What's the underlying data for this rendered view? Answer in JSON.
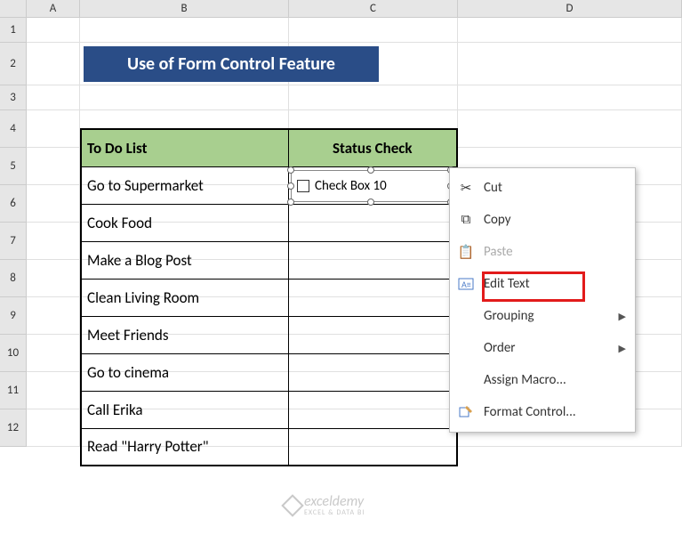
{
  "columns": [
    "A",
    "B",
    "C",
    "D"
  ],
  "rows": [
    "1",
    "2",
    "3",
    "4",
    "5",
    "6",
    "7",
    "8",
    "9",
    "10",
    "11",
    "12"
  ],
  "title": "Use of Form Control Feature",
  "headers": {
    "todo": "To Do List",
    "status": "Status Check"
  },
  "tasks": [
    "Go to Supermarket",
    "Cook Food",
    "Make a Blog Post",
    "Clean Living Room",
    "Meet Friends",
    "Go to cinema",
    "Call Erika",
    "Read \"Harry Potter\""
  ],
  "checkbox_label": "Check Box 10",
  "menu": {
    "cut": "Cut",
    "copy": "Copy",
    "paste": "Paste",
    "edit_text": "Edit Text",
    "grouping": "Grouping",
    "order": "Order",
    "assign_macro": "Assign Macro...",
    "format_control": "Format Control..."
  },
  "watermark": {
    "brand": "exceldemy",
    "sub": "EXCEL & DATA BI"
  }
}
